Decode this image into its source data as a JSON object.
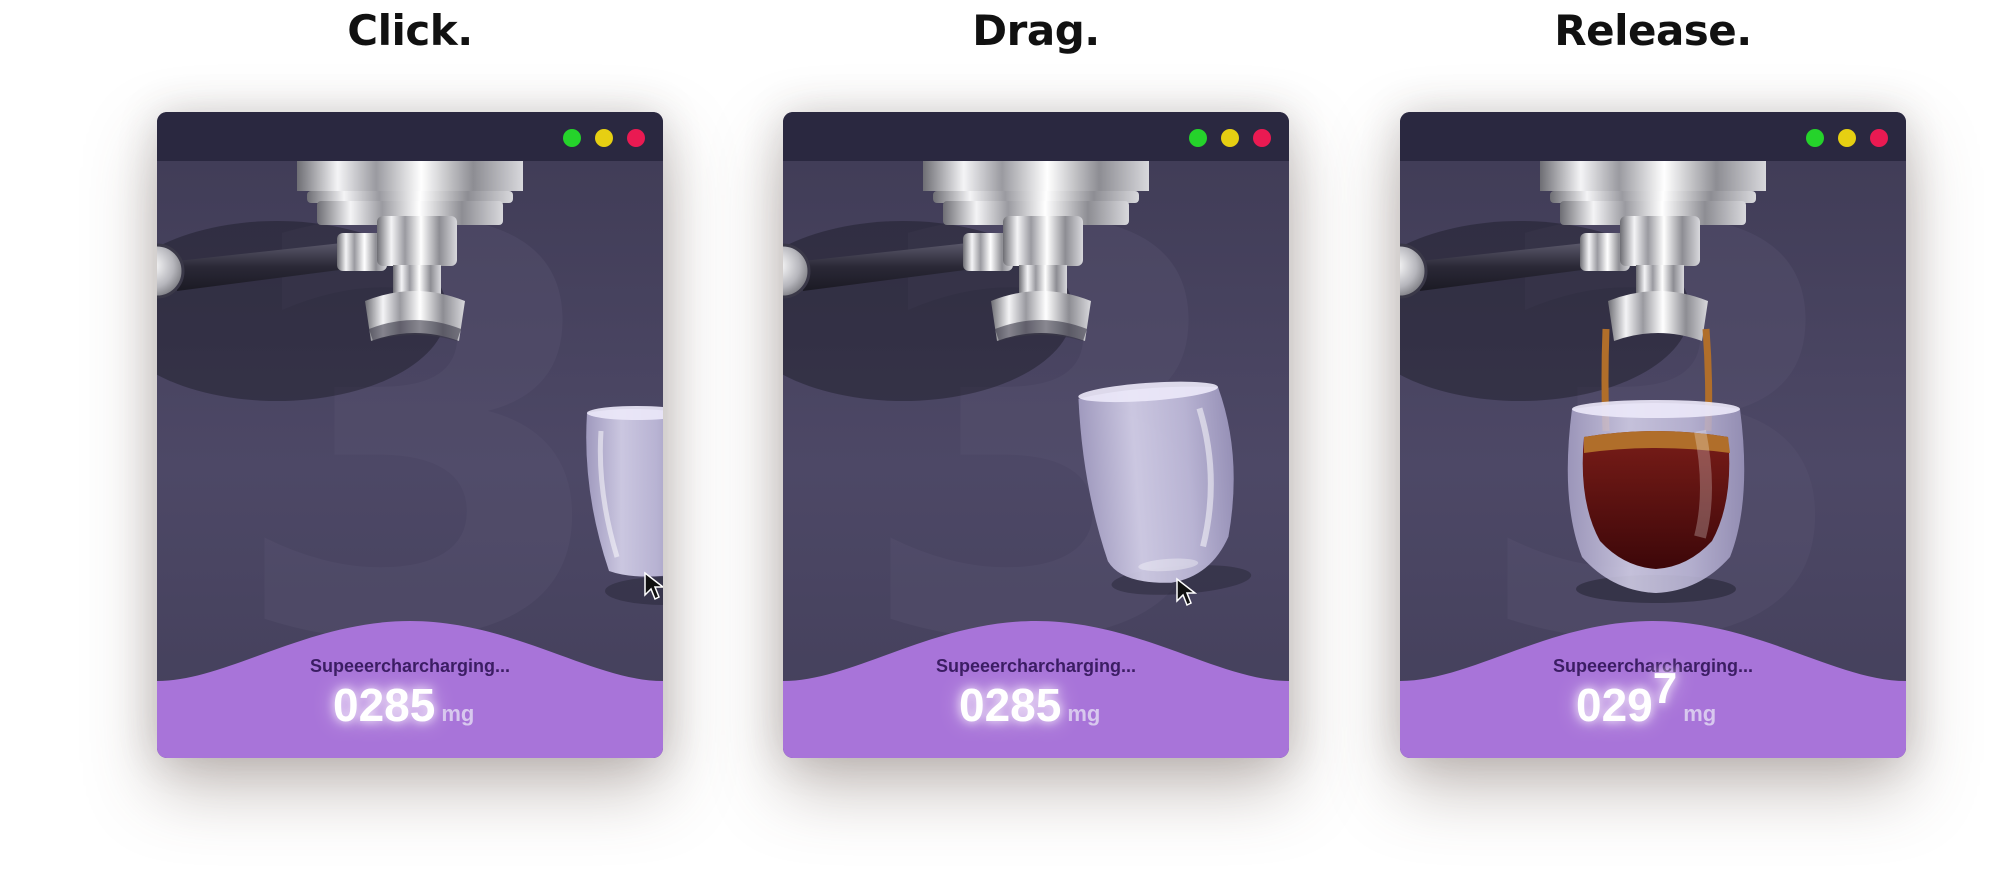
{
  "steps": [
    {
      "title": "Click.",
      "status": "Supeeercharcharging...",
      "reading": {
        "main": "0285",
        "extra": "",
        "unit": "mg"
      },
      "cup": "idle"
    },
    {
      "title": "Drag.",
      "status": "Supeeercharcharging...",
      "reading": {
        "main": "0285",
        "extra": "",
        "unit": "mg"
      },
      "cup": "dragging"
    },
    {
      "title": "Release.",
      "status": "Supeeercharcharging...",
      "reading": {
        "main": "029",
        "extra": "7",
        "unit": "mg"
      },
      "cup": "filled"
    }
  ],
  "background_digit": "3",
  "window_controls": [
    "maximize",
    "minimize",
    "close"
  ],
  "colors": {
    "titlebar": "#2a2840",
    "panel": "#4a4563",
    "wave": "#a874d9",
    "status_text": "#3b1d63",
    "dot_green": "#25d32b",
    "dot_yellow": "#e6cf12",
    "dot_red": "#ea1a52",
    "coffee": "#5a0f12",
    "crema": "#b06e2a"
  }
}
